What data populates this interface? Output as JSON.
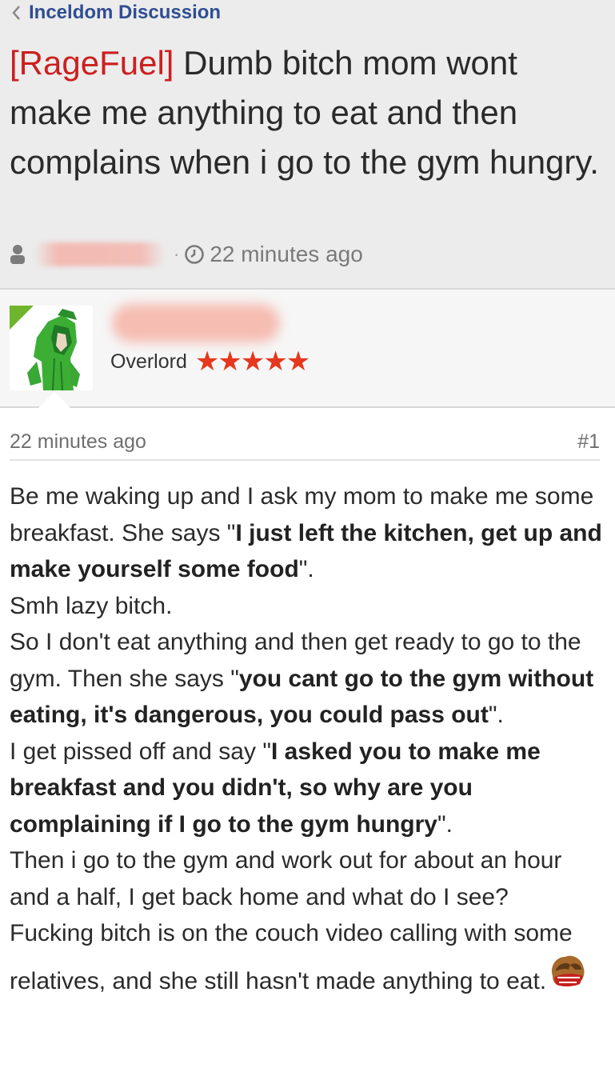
{
  "nav": {
    "back_label": "Inceldom Discussion"
  },
  "thread": {
    "tag": "[RageFuel]",
    "title": " Dumb bitch mom wont make me anything to eat and then complains when i go to the gym hungry.",
    "time": "22 minutes ago"
  },
  "author": {
    "rank": "Overlord",
    "stars": "★★★★★"
  },
  "post": {
    "time": "22 minutes ago",
    "number": "#1",
    "p1_a": "Be me waking up and I ask my mom to make me some breakfast. She says \"",
    "p1_b": "I just left the kitchen, get up and make yourself some food",
    "p1_c": "\".",
    "p2": "Smh lazy bitch.",
    "p3_a": "So I don't eat anything and then get ready to go to the gym. Then she says \"",
    "p3_b": "you cant go to the gym without eating, it's dangerous, you could pass out",
    "p3_c": "\".",
    "p4_a": "I get pissed off and say \"",
    "p4_b": "I asked you to make me breakfast and you didn't, so why are you complaining if I go to the gym hungry",
    "p4_c": "\".",
    "p5": "Then i go to the gym and work out for about an hour and a half, I get back home and what do I see?",
    "p6": "Fucking bitch is on the couch video calling with some relatives, and she still hasn't made anything to eat."
  },
  "colors": {
    "tag_red": "#cc1f1f",
    "nav_blue": "#2f4d92",
    "star_red": "#e5381e",
    "corner_green": "#6fb52c"
  }
}
